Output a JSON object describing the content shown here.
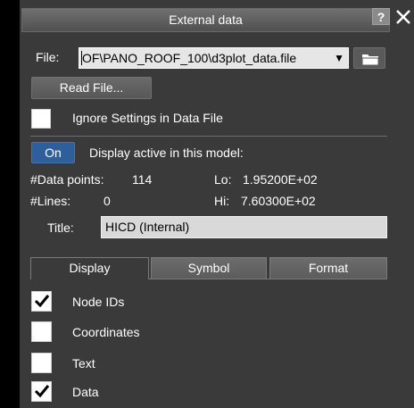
{
  "window": {
    "title": "External data",
    "help_label": "?"
  },
  "file": {
    "label": "File:",
    "value_prefix": "O",
    "value_rest": "F\\PANO_ROOF_100\\d3plot_data.file",
    "dropdown_arrow": "▼",
    "read_button": "Read File..."
  },
  "ignore_settings": {
    "label": "Ignore Settings in Data File",
    "checked": false
  },
  "display_active": {
    "toggle_label": "On",
    "label": "Display active in this model:"
  },
  "stats": {
    "points_label": "#Data points:",
    "points_value": "114",
    "lines_label": "#Lines:",
    "lines_value": "0",
    "lo_label": "Lo:",
    "lo_value": "1.95200E+02",
    "hi_label": "Hi:",
    "hi_value": "7.60300E+02"
  },
  "title_field": {
    "label": "Title:",
    "value": "HICD (Internal)"
  },
  "tabs": [
    {
      "label": "Display",
      "active": true
    },
    {
      "label": "Symbol",
      "active": false
    },
    {
      "label": "Format",
      "active": false
    }
  ],
  "options": [
    {
      "label": "Node IDs",
      "checked": true
    },
    {
      "label": "Coordinates",
      "checked": false
    },
    {
      "label": "Text",
      "checked": false
    },
    {
      "label": "Data",
      "checked": true
    }
  ],
  "colors": {
    "panel_bg": "#3a3a3a",
    "accent_on": "#2f5f9a"
  },
  "icons": {
    "close": "close-icon",
    "folder": "folder-icon",
    "check": "check-icon"
  }
}
